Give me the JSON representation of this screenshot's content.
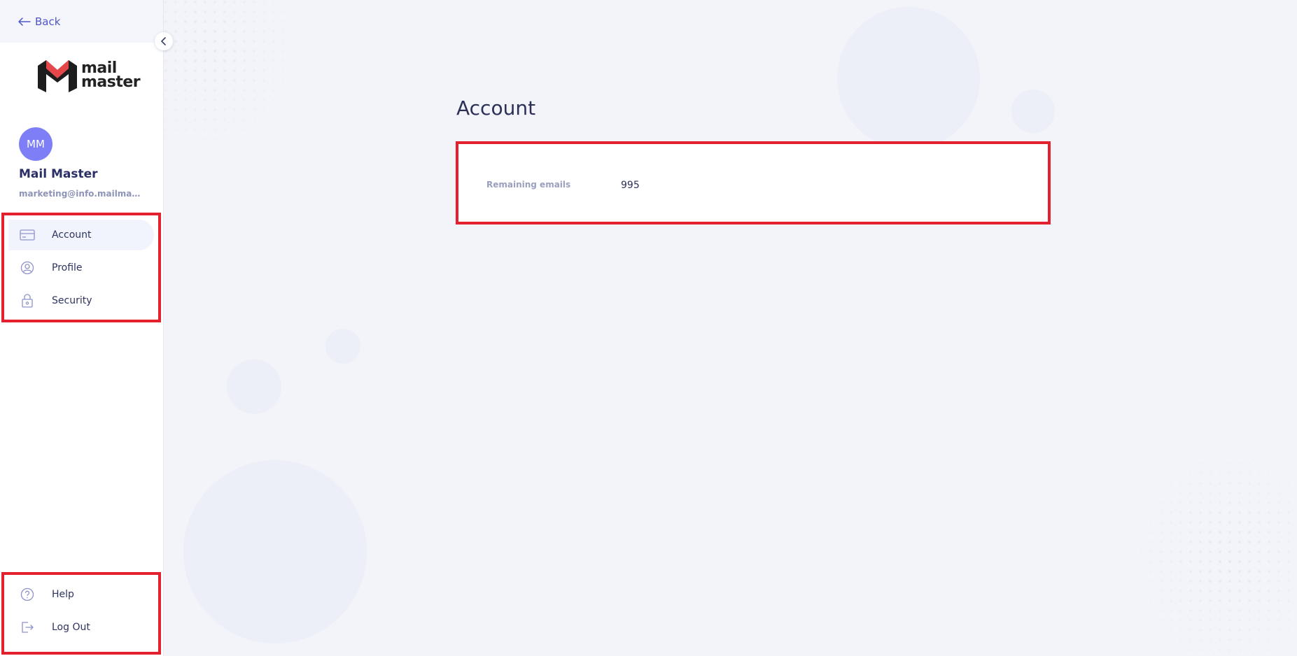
{
  "nav": {
    "back_label": "Back"
  },
  "brand": {
    "logo_text_line1": "mail",
    "logo_text_line2": "master",
    "accent_color": "#e5474b"
  },
  "user": {
    "initials": "MM",
    "name": "Mail Master",
    "email": "marketing@info.mailmaster.c...",
    "avatar_color": "#7e7ff7"
  },
  "sidebar": {
    "items": [
      {
        "label": "Account",
        "icon": "credit-card-icon",
        "active": true
      },
      {
        "label": "Profile",
        "icon": "user-circle-icon",
        "active": false
      },
      {
        "label": "Security",
        "icon": "lock-icon",
        "active": false
      }
    ],
    "footer_items": [
      {
        "label": "Help",
        "icon": "help-circle-icon"
      },
      {
        "label": "Log Out",
        "icon": "logout-icon"
      }
    ]
  },
  "main": {
    "title": "Account",
    "card": {
      "label": "Remaining emails",
      "value": "995"
    }
  },
  "colors": {
    "highlight_border": "#e3202d",
    "link": "#4f55c9",
    "text": "#2c3057",
    "background": "#f3f4f9"
  }
}
